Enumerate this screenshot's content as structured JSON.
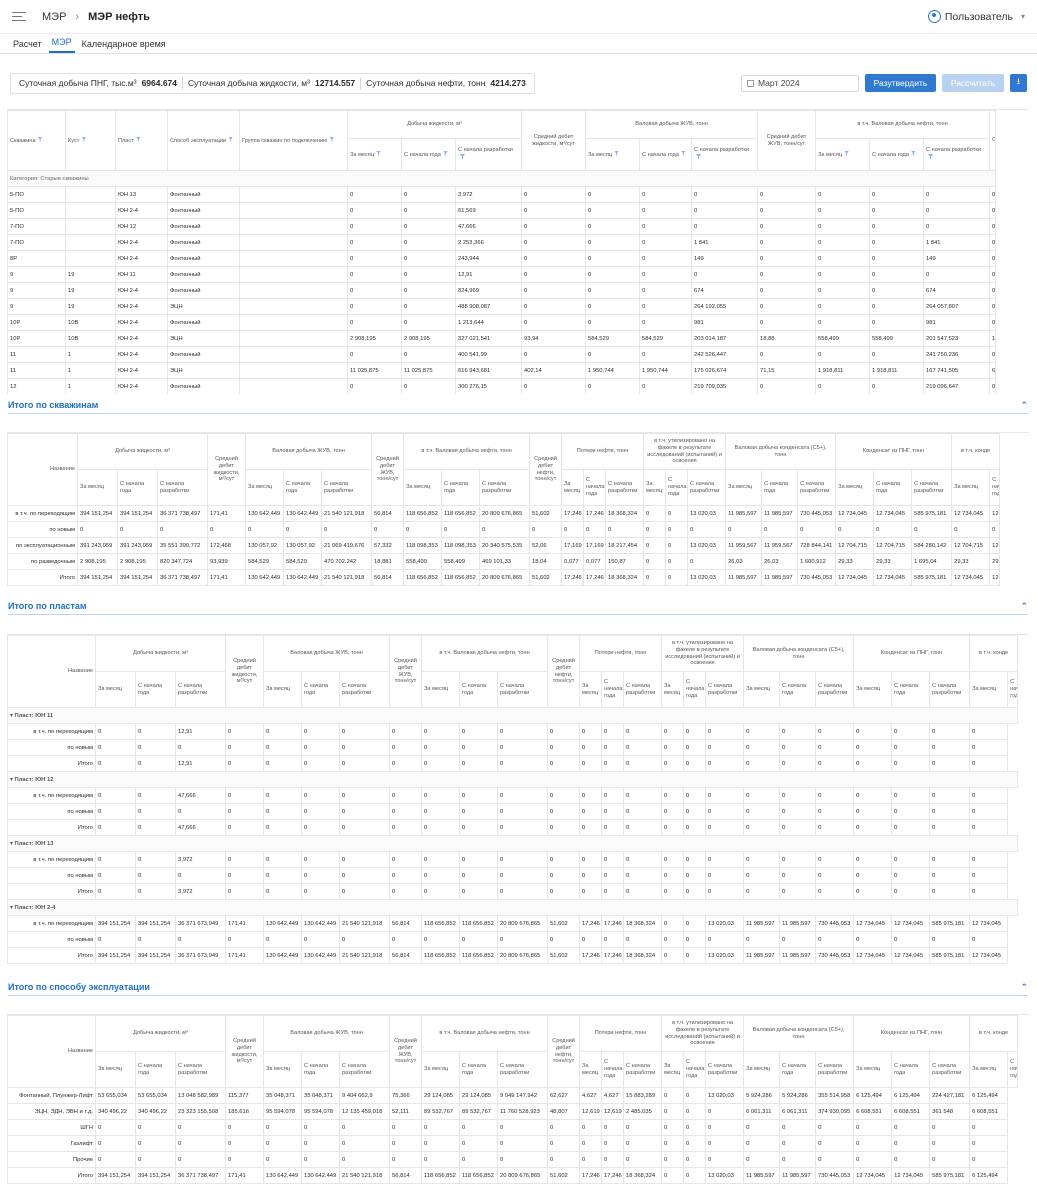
{
  "header": {
    "crumb1": "МЭР",
    "crumb2": "МЭР нефть",
    "user": "Пользователь"
  },
  "tabs": [
    "Расчет",
    "МЭР",
    "Календарное время"
  ],
  "stats": [
    {
      "label": "Суточная добыча ПНГ, тыс.м³",
      "value": "6964.674"
    },
    {
      "label": "Суточная добыча жидкости, м³",
      "value": "12714.557"
    },
    {
      "label": "Суточная добыча нефти, тонн",
      "value": "4214.273"
    }
  ],
  "toolbar": {
    "date": "Март 2024",
    "approve": "Разутвердить",
    "calc": "Рассчитать"
  },
  "wells": {
    "headers": [
      "Скважина",
      "Куст",
      "Пласт",
      "Способ эксплуатации",
      "Группа скважин по подключению",
      "Добыча жидкости, м³",
      "Средний дебит жидкости, м³/сут",
      "Валовая добыча ЖУВ, тонн",
      "Средний дебит ЖУВ, тонн/сут",
      "в т.ч. Валовая добыча нефти, тонн",
      "Сре"
    ],
    "sub": [
      "За месяц",
      "С начала года",
      "С начала разработки"
    ],
    "category": "Категория: Старые скважины",
    "rows": [
      [
        "5-ПО",
        "",
        "ЮН 13",
        "Фонтанный",
        "",
        "0",
        "0",
        "3,972",
        "0",
        "0",
        "0",
        "0",
        "0",
        "0",
        "0",
        "0",
        "0"
      ],
      [
        "5-ПО",
        "",
        "ЮН 2-4",
        "Фонтанный",
        "",
        "0",
        "0",
        "61,569",
        "0",
        "0",
        "0",
        "0",
        "0",
        "0",
        "0",
        "0",
        "0"
      ],
      [
        "7-ПО",
        "",
        "ЮН 12",
        "Фонтанный",
        "",
        "0",
        "0",
        "47,666",
        "0",
        "0",
        "0",
        "0",
        "0",
        "0",
        "0",
        "0",
        "0"
      ],
      [
        "7-ПО",
        "",
        "ЮН 2-4",
        "Фонтанный",
        "",
        "0",
        "0",
        "2 253,366",
        "0",
        "0",
        "0",
        "1 841",
        "0",
        "0",
        "0",
        "1 841",
        "0"
      ],
      [
        "8Р",
        "",
        "ЮН 2-4",
        "Фонтанный",
        "",
        "0",
        "0",
        "243,944",
        "0",
        "0",
        "0",
        "149",
        "0",
        "0",
        "0",
        "149",
        "0"
      ],
      [
        "9",
        "19",
        "ЮН 11",
        "Фонтанный",
        "",
        "0",
        "0",
        "12,91",
        "0",
        "0",
        "0",
        "0",
        "0",
        "0",
        "0",
        "0",
        "0"
      ],
      [
        "9",
        "19",
        "ЮН 2-4",
        "Фонтанный",
        "",
        "0",
        "0",
        "824,969",
        "0",
        "0",
        "0",
        "674",
        "0",
        "0",
        "0",
        "674",
        "0"
      ],
      [
        "9",
        "19",
        "ЮН 2-4",
        "ЭЦН",
        "",
        "0",
        "0",
        "488 908,087",
        "0",
        "0",
        "0",
        "264 192,055",
        "0",
        "0",
        "0",
        "264 057,807",
        "0"
      ],
      [
        "10Р",
        "10В",
        "ЮН 2-4",
        "Фонтанный",
        "",
        "0",
        "0",
        "1 213,644",
        "0",
        "0",
        "0",
        "981",
        "0",
        "0",
        "0",
        "981",
        "0"
      ],
      [
        "10Р",
        "10В",
        "ЮН 2-4",
        "ЭЦН",
        "",
        "2 908,195",
        "2 908,195",
        "327 021,541",
        "93,94",
        "584,529",
        "584,529",
        "203 014,187",
        "18,88",
        "558,499",
        "558,499",
        "201 547,523",
        "18,"
      ],
      [
        "11",
        "1",
        "ЮН 2-4",
        "Фонтанный",
        "",
        "0",
        "0",
        "400 541,99",
        "0",
        "0",
        "0",
        "242 526,447",
        "0",
        "0",
        "0",
        "241 750,236",
        "0"
      ],
      [
        "11",
        "1",
        "ЮН 2-4",
        "ЭЦН",
        "",
        "11 025,875",
        "11 025,875",
        "616 943,681",
        "402,14",
        "1 950,744",
        "1 950,744",
        "175 026,674",
        "71,15",
        "1 918,811",
        "1 918,811",
        "167 741,505",
        "69,"
      ],
      [
        "12",
        "1",
        "ЮН 2-4",
        "Фонтанный",
        "",
        "0",
        "0",
        "300 276,15",
        "0",
        "0",
        "0",
        "219 709,035",
        "0",
        "0",
        "0",
        "219 096,647",
        "0"
      ]
    ]
  },
  "sections": {
    "wells": "Итого по скважинам",
    "plasts": "Итого по пластам",
    "methods": "Итого по способу эксплуатации"
  },
  "summary_headers": {
    "name": "Название",
    "liquid": "Добыча жидкости, м³",
    "avg_liquid": "Средний дебит жидкости, м³/сут",
    "zhuv": "Валовая добыча ЖУВ, тонн",
    "avg_zhuv": "Средний дебит ЖУВ, тонн/сут",
    "oil": "в т.ч. Валовая добыча нефти, тонн",
    "avg_oil": "Средний дебит нефти, тонн/сут",
    "loss": "Потери нефти, тонн",
    "flare": "в т.ч. утилизировано на факеле в результате исследований (испытаний) и освоения",
    "cond": "Валовая добыча конденсата (С5+), тонн",
    "png": "Конденсат из ПНГ, тонн",
    "png2": "в т.ч. конде",
    "month": "За месяц",
    "year": "С начала года",
    "dev": "С начала разработки"
  },
  "totals_wells": [
    [
      "в т.ч. по переходящим",
      "394 151,254",
      "394 151,254",
      "36 371 738,497",
      "171,41",
      "130 642,449",
      "130 642,449",
      "21 540 121,918",
      "56,814",
      "118 656,852",
      "118 656,852",
      "20 809 676,865",
      "51,602",
      "17,246",
      "17,246",
      "18 368,324",
      "0",
      "0",
      "13 020,03",
      "11 985,597",
      "11 985,597",
      "730 445,053",
      "12 734,045",
      "12 734,045",
      "585 975,181",
      "12 734,045",
      "12"
    ],
    [
      "по новым",
      "0",
      "0",
      "0",
      "0",
      "0",
      "0",
      "0",
      "0",
      "0",
      "0",
      "0",
      "0",
      "0",
      "0",
      "0",
      "0",
      "0",
      "0",
      "0",
      "0",
      "0",
      "0",
      "0",
      "0",
      "0",
      "0"
    ],
    [
      "по эксплуатационным",
      "391 243,059",
      "391 243,059",
      "35 551 390,772",
      "172,468",
      "130 057,92",
      "130 057,92",
      "21 069 419,676",
      "57,332",
      "118 098,353",
      "118 098,353",
      "20 340 575,535",
      "52,06",
      "17,169",
      "17,169",
      "18 217,454",
      "0",
      "0",
      "13 020,03",
      "11 959,567",
      "11 959,567",
      "728 844,141",
      "12 704,715",
      "12 704,715",
      "584 280,142",
      "12 704,715",
      "12"
    ],
    [
      "по разведочным",
      "2 908,195",
      "2 908,195",
      "820 347,724",
      "93,939",
      "584,529",
      "584,529",
      "470 702,242",
      "18,881",
      "558,499",
      "558,499",
      "469 101,33",
      "18,04",
      "0,077",
      "0,077",
      "150,87",
      "0",
      "0",
      "0",
      "26,03",
      "26,03",
      "1 600,912",
      "29,33",
      "29,33",
      "1 695,04",
      "29,33",
      "29"
    ],
    [
      "Итого",
      "394 151,254",
      "394 151,254",
      "36 371 738,497",
      "171,41",
      "130 642,449",
      "130 642,449",
      "21 540 121,918",
      "56,814",
      "118 656,852",
      "118 656,852",
      "20 809 676,865",
      "51,602",
      "17,246",
      "17,246",
      "18 368,324",
      "0",
      "0",
      "13 020,03",
      "11 985,597",
      "11 985,597",
      "730 445,053",
      "12 734,045",
      "12 734,045",
      "585 975,181",
      "12 734,045",
      "12"
    ]
  ],
  "plast_groups": [
    {
      "title": "Пласт: ЮН 11",
      "rows": [
        [
          "в т.ч. по переходящим",
          "0",
          "0",
          "12,91",
          "0",
          "0",
          "0",
          "0",
          "0",
          "0",
          "0",
          "0",
          "0",
          "0",
          "0",
          "0",
          "0",
          "0",
          "0",
          "0",
          "0",
          "0",
          "0",
          "0",
          "0",
          "0"
        ],
        [
          "по новым",
          "0",
          "0",
          "0",
          "0",
          "0",
          "0",
          "0",
          "0",
          "0",
          "0",
          "0",
          "0",
          "0",
          "0",
          "0",
          "0",
          "0",
          "0",
          "0",
          "0",
          "0",
          "0",
          "0",
          "0",
          "0"
        ],
        [
          "Итого",
          "0",
          "0",
          "12,91",
          "0",
          "0",
          "0",
          "0",
          "0",
          "0",
          "0",
          "0",
          "0",
          "0",
          "0",
          "0",
          "0",
          "0",
          "0",
          "0",
          "0",
          "0",
          "0",
          "0",
          "0",
          "0"
        ]
      ]
    },
    {
      "title": "Пласт: ЮН 12",
      "rows": [
        [
          "в т.ч. по переходящим",
          "0",
          "0",
          "47,666",
          "0",
          "0",
          "0",
          "0",
          "0",
          "0",
          "0",
          "0",
          "0",
          "0",
          "0",
          "0",
          "0",
          "0",
          "0",
          "0",
          "0",
          "0",
          "0",
          "0",
          "0",
          "0"
        ],
        [
          "по новым",
          "0",
          "0",
          "0",
          "0",
          "0",
          "0",
          "0",
          "0",
          "0",
          "0",
          "0",
          "0",
          "0",
          "0",
          "0",
          "0",
          "0",
          "0",
          "0",
          "0",
          "0",
          "0",
          "0",
          "0",
          "0"
        ],
        [
          "Итого",
          "0",
          "0",
          "47,666",
          "0",
          "0",
          "0",
          "0",
          "0",
          "0",
          "0",
          "0",
          "0",
          "0",
          "0",
          "0",
          "0",
          "0",
          "0",
          "0",
          "0",
          "0",
          "0",
          "0",
          "0",
          "0"
        ]
      ]
    },
    {
      "title": "Пласт: ЮН 13",
      "rows": [
        [
          "в т.ч. по переходящим",
          "0",
          "0",
          "3,972",
          "0",
          "0",
          "0",
          "0",
          "0",
          "0",
          "0",
          "0",
          "0",
          "0",
          "0",
          "0",
          "0",
          "0",
          "0",
          "0",
          "0",
          "0",
          "0",
          "0",
          "0",
          "0"
        ],
        [
          "по новым",
          "0",
          "0",
          "0",
          "0",
          "0",
          "0",
          "0",
          "0",
          "0",
          "0",
          "0",
          "0",
          "0",
          "0",
          "0",
          "0",
          "0",
          "0",
          "0",
          "0",
          "0",
          "0",
          "0",
          "0",
          "0"
        ],
        [
          "Итого",
          "0",
          "0",
          "3,972",
          "0",
          "0",
          "0",
          "0",
          "0",
          "0",
          "0",
          "0",
          "0",
          "0",
          "0",
          "0",
          "0",
          "0",
          "0",
          "0",
          "0",
          "0",
          "0",
          "0",
          "0",
          "0"
        ]
      ]
    },
    {
      "title": "Пласт: ЮН 2-4",
      "rows": [
        [
          "в т.ч. по переходящим",
          "394 151,254",
          "394 151,254",
          "36 371 673,949",
          "171,41",
          "130 642,449",
          "130 642,449",
          "21 540 121,918",
          "56,814",
          "118 656,852",
          "118 656,852",
          "20 809 676,865",
          "51,602",
          "17,246",
          "17,246",
          "18 368,324",
          "0",
          "0",
          "13 020,03",
          "11 985,597",
          "11 985,597",
          "730 445,053",
          "12 734,045",
          "12 734,045",
          "585 975,181",
          "12 734,045"
        ],
        [
          "по новым",
          "0",
          "0",
          "0",
          "0",
          "0",
          "0",
          "0",
          "0",
          "0",
          "0",
          "0",
          "0",
          "0",
          "0",
          "0",
          "0",
          "0",
          "0",
          "0",
          "0",
          "0",
          "0",
          "0",
          "0",
          "0"
        ],
        [
          "Итого",
          "394 151,254",
          "394 151,254",
          "36 371 673,949",
          "171,41",
          "130 642,449",
          "130 642,449",
          "21 540 121,918",
          "56,814",
          "118 656,852",
          "118 656,852",
          "20 809 676,865",
          "51,602",
          "17,246",
          "17,246",
          "18 368,324",
          "0",
          "0",
          "13 020,03",
          "11 985,597",
          "11 985,597",
          "730 445,053",
          "12 734,045",
          "12 734,045",
          "585 975,181",
          "12 734,045"
        ]
      ]
    }
  ],
  "methods": [
    [
      "Фонтанный, Плунжер-Лифт",
      "53 655,034",
      "53 655,034",
      "13 048 582,989",
      "115,377",
      "35 048,371",
      "35 048,371",
      "9 404 662,9",
      "75,366",
      "29 124,085",
      "29 124,085",
      "9 049 147,942",
      "62,627",
      "4,627",
      "4,627",
      "15 883,289",
      "0",
      "0",
      "13 020,03",
      "5 924,286",
      "5 924,286",
      "355 514,958",
      "6 125,494",
      "6 125,494",
      "224 427,181",
      "6 125,494"
    ],
    [
      "ЭЦН, ЭДН, ЭВН и т.д.",
      "340 496,22",
      "340 496,22",
      "23 323 155,508",
      "185,616",
      "95 594,078",
      "95 594,078",
      "12 135 459,018",
      "52,111",
      "89 532,767",
      "89 532,767",
      "11 760 528,923",
      "48,807",
      "12,619",
      "12,619",
      "2 485,035",
      "0",
      "0",
      "0",
      "6 061,311",
      "6 061,311",
      "374 930,095",
      "6 608,551",
      "6 608,551",
      "361 548",
      "6 608,551"
    ],
    [
      "ШГН",
      "0",
      "0",
      "0",
      "0",
      "0",
      "0",
      "0",
      "0",
      "0",
      "0",
      "0",
      "0",
      "0",
      "0",
      "0",
      "0",
      "0",
      "0",
      "0",
      "0",
      "0",
      "0",
      "0",
      "0",
      "0"
    ],
    [
      "Газлифт",
      "0",
      "0",
      "0",
      "0",
      "0",
      "0",
      "0",
      "0",
      "0",
      "0",
      "0",
      "0",
      "0",
      "0",
      "0",
      "0",
      "0",
      "0",
      "0",
      "0",
      "0",
      "0",
      "0",
      "0",
      "0"
    ],
    [
      "Прочие",
      "0",
      "0",
      "0",
      "0",
      "0",
      "0",
      "0",
      "0",
      "0",
      "0",
      "0",
      "0",
      "0",
      "0",
      "0",
      "0",
      "0",
      "0",
      "0",
      "0",
      "0",
      "0",
      "0",
      "0",
      "0"
    ],
    [
      "Итого",
      "394 151,254",
      "394 151,254",
      "36 371 738,497",
      "171,41",
      "130 642,449",
      "130 642,449",
      "21 540 121,918",
      "56,814",
      "118 656,852",
      "118 656,852",
      "20 809 676,865",
      "51,602",
      "17,246",
      "17,246",
      "18 368,324",
      "0",
      "0",
      "13 020,03",
      "11 985,597",
      "11 985,597",
      "730 445,053",
      "12 734,045",
      "12 734,045",
      "585 975,181",
      "6 125,494"
    ]
  ]
}
